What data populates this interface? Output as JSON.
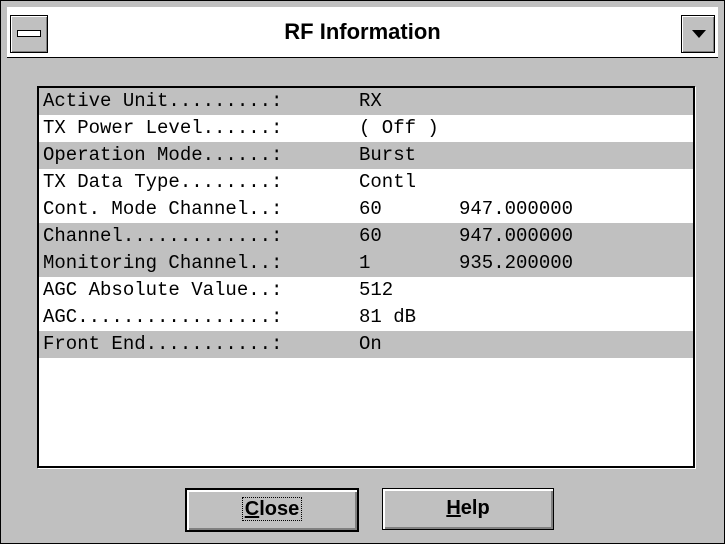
{
  "window": {
    "title": "RF Information"
  },
  "rows": [
    {
      "label": "Active Unit.........:",
      "value": "RX",
      "freq": "",
      "shaded": true
    },
    {
      "label": "TX Power Level......:",
      "value": "( Off )",
      "freq": "",
      "shaded": false
    },
    {
      "label": "Operation Mode......:",
      "value": "Burst",
      "freq": "",
      "shaded": true
    },
    {
      "label": "TX Data Type........:",
      "value": "Contl",
      "freq": "",
      "shaded": false
    },
    {
      "label": "Cont. Mode Channel..:",
      "value": "60",
      "freq": "947.000000",
      "shaded": false
    },
    {
      "label": "Channel.............:",
      "value": "60",
      "freq": "947.000000",
      "shaded": true
    },
    {
      "label": "Monitoring Channel..:",
      "value": "1",
      "freq": "935.200000",
      "shaded": true
    },
    {
      "label": "AGC Absolute Value..:",
      "value": "512",
      "freq": "",
      "shaded": false
    },
    {
      "label": "AGC.................:",
      "value": "81 dB",
      "freq": "",
      "shaded": false
    },
    {
      "label": "Front End...........:",
      "value": "On",
      "freq": "",
      "shaded": true
    }
  ],
  "buttons": {
    "close_label": "Close",
    "help_label": "Help"
  },
  "icons": {
    "system_menu": "system-menu-icon",
    "dropdown": "chevron-down-icon"
  }
}
